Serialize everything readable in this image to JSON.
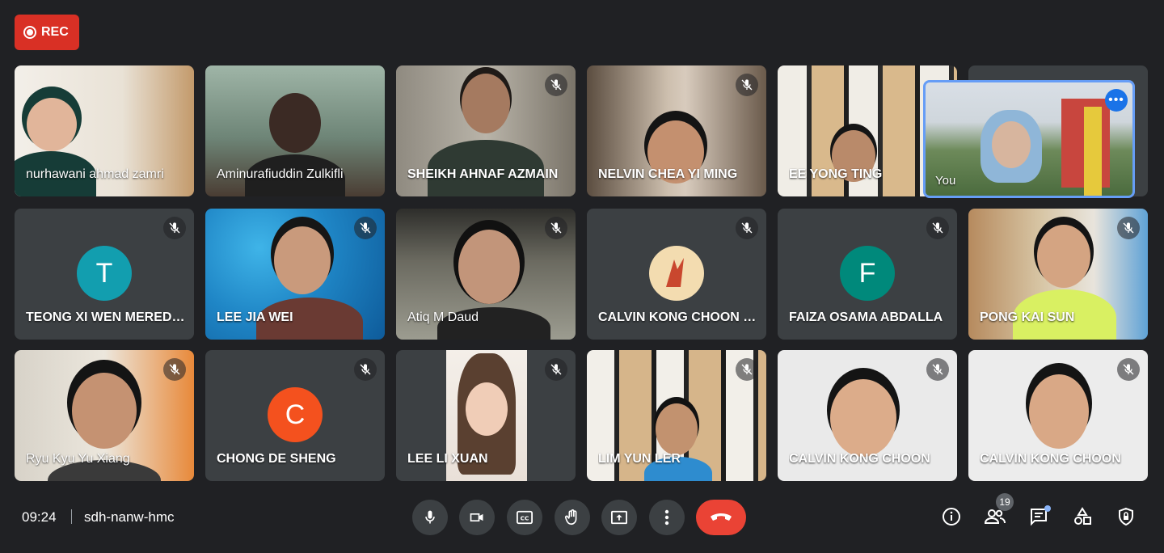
{
  "recording": {
    "label": "REC"
  },
  "participants": [
    {
      "name": "nurhawani ahmad zamri"
    },
    {
      "name": "Aminurafiuddin Zulkifli"
    },
    {
      "name": "SHEIKH AHNAF AZMAIN"
    },
    {
      "name": "NELVIN CHEA YI MING"
    },
    {
      "name": "EE YONG TING"
    },
    {
      "name": "TEONG XI WEN MEREDITH",
      "avatar_letter": "T",
      "avatar_color": "#129eaf"
    },
    {
      "name": "LEE JIA WEI"
    },
    {
      "name": "Atiq M Daud"
    },
    {
      "name": "CALVIN KONG CHOON HOE"
    },
    {
      "name": "FAIZA OSAMA ABDALLA",
      "avatar_letter": "F",
      "avatar_color": "#00897b"
    },
    {
      "name": "PONG KAI SUN"
    },
    {
      "name": "Ryu Kyu Yu Xiang"
    },
    {
      "name": "CHONG DE SHENG",
      "avatar_letter": "C",
      "avatar_color": "#f4511e"
    },
    {
      "name": "LEE LI XUAN"
    },
    {
      "name": "LIM YUN LER"
    },
    {
      "name": "CALVIN KONG CHOON"
    },
    {
      "name": "CALVIN KONG CHOON"
    }
  ],
  "self_view": {
    "label": "You"
  },
  "meeting": {
    "time": "09:24",
    "code": "sdh-nanw-hmc"
  },
  "people_count": "19",
  "colors": {
    "accent": "#1a73e8",
    "hangup": "#ea4335",
    "rec": "#d93025",
    "self_border": "#669df6"
  }
}
